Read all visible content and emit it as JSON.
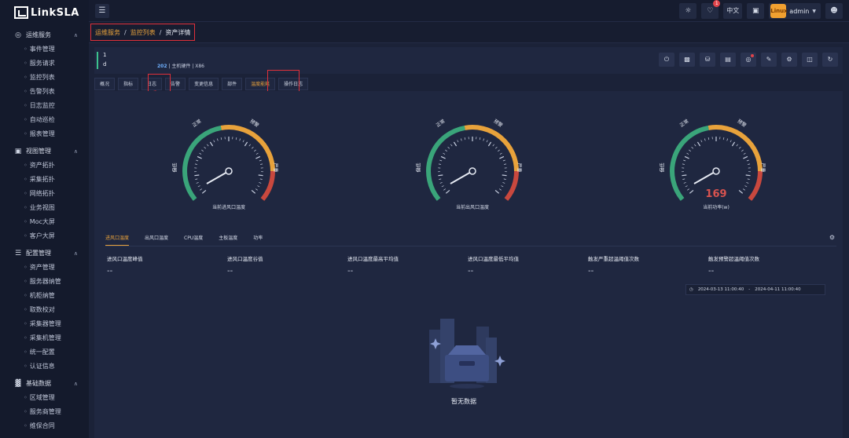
{
  "app": {
    "logo": "LinkSLA"
  },
  "topbar": {
    "menu_icon": "menu-icon",
    "notification_count": "1",
    "lang_label": "中文",
    "user_name": "admin",
    "avatar_text": "Linux"
  },
  "sidebar": {
    "groups": [
      {
        "label": "运维服务",
        "icon": "globe-icon",
        "items": [
          "事件管理",
          "服务请求",
          "监控列表",
          "告警列表",
          "日志监控",
          "自动巡检",
          "报表管理"
        ]
      },
      {
        "label": "视图管理",
        "icon": "monitor-icon",
        "items": [
          "资产拓扑",
          "采集拓扑",
          "网络拓扑",
          "业务视图",
          "Moc大屏",
          "客户大屏"
        ]
      },
      {
        "label": "配置管理",
        "icon": "settings-icon",
        "items": [
          "资产管理",
          "服务器纳管",
          "机柜纳管",
          "取数校对",
          "采集器管理",
          "采集机管理",
          "统一配置",
          "认证信息"
        ]
      },
      {
        "label": "基础数据",
        "icon": "chart-icon",
        "items": [
          "区域管理",
          "服务商管理",
          "维保合同"
        ]
      }
    ]
  },
  "breadcrumb": {
    "level1": "运维服务",
    "level2": "监控列表",
    "current": "资产详情",
    "sep": "/"
  },
  "asset": {
    "id": "1",
    "sub": "d",
    "meta_highlight": "202",
    "meta_rest": "| 主机硬件 | X86"
  },
  "tabs": [
    "概况",
    "指标",
    "日志",
    "告警",
    "变更信息",
    "部件",
    "温度能耗",
    "操作日志"
  ],
  "active_tab": "温度能耗",
  "gauges": [
    {
      "title": "当前进风口温度",
      "value": "",
      "label_normal": "正常",
      "label_warn": "预警",
      "label_serious": "严重",
      "label_low": "偏低"
    },
    {
      "title": "当前出风口温度",
      "value": "",
      "label_normal": "正常",
      "label_warn": "预警",
      "label_serious": "严重",
      "label_low": "偏低"
    },
    {
      "title": "当前功率(w)",
      "value": "169",
      "label_normal": "正常",
      "label_warn": "预警",
      "label_serious": "严重",
      "label_low": "偏低"
    }
  ],
  "sub_tabs": [
    "进风口温度",
    "出风口温度",
    "CPU温度",
    "主板温度",
    "功率"
  ],
  "stats": [
    {
      "label": "进风口温度峰值",
      "value": "--"
    },
    {
      "label": "进风口温度谷值",
      "value": "--"
    },
    {
      "label": "进风口温度最高平均值",
      "value": "--"
    },
    {
      "label": "进风口温度最低平均值",
      "value": "--"
    },
    {
      "label": "触发严重超温阈值次数",
      "value": "--"
    },
    {
      "label": "触发预警超温阈值次数",
      "value": "--"
    }
  ],
  "date_range": {
    "start": "2024-03-13 11:00:40",
    "sep": "-",
    "end": "2024-04-11 11:00:40"
  },
  "empty_text": "暂无数据",
  "colors": {
    "accent": "#e8a23b",
    "normal": "#3aa57a",
    "warn": "#e8a23b",
    "serious": "#c9483e",
    "highlight_box": "#e0303a"
  }
}
